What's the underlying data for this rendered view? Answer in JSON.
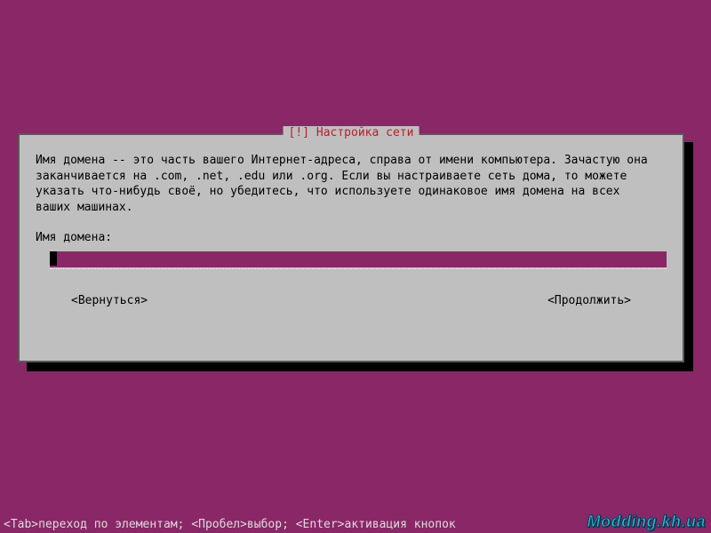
{
  "dialog": {
    "title": "[!] Настройка сети",
    "description": "Имя домена -- это часть вашего Интернет-адреса, справа от имени компьютера. Зачастую она\nзаканчивается на .com, .net, .edu или .org. Если вы настраиваете сеть дома, то можете\nуказать что-нибудь своё, но убедитесь, что используете одинаковое имя домена на всех\nваших машинах.",
    "prompt_label": "Имя домена:",
    "input_value": "",
    "back_label": "<Вернуться>",
    "continue_label": "<Продолжить>"
  },
  "footer": {
    "hints": "<Tab>переход по элементам; <Пробел>выбор; <Enter>активация кнопок"
  },
  "watermark": {
    "text": "Modding.kh.ua"
  }
}
